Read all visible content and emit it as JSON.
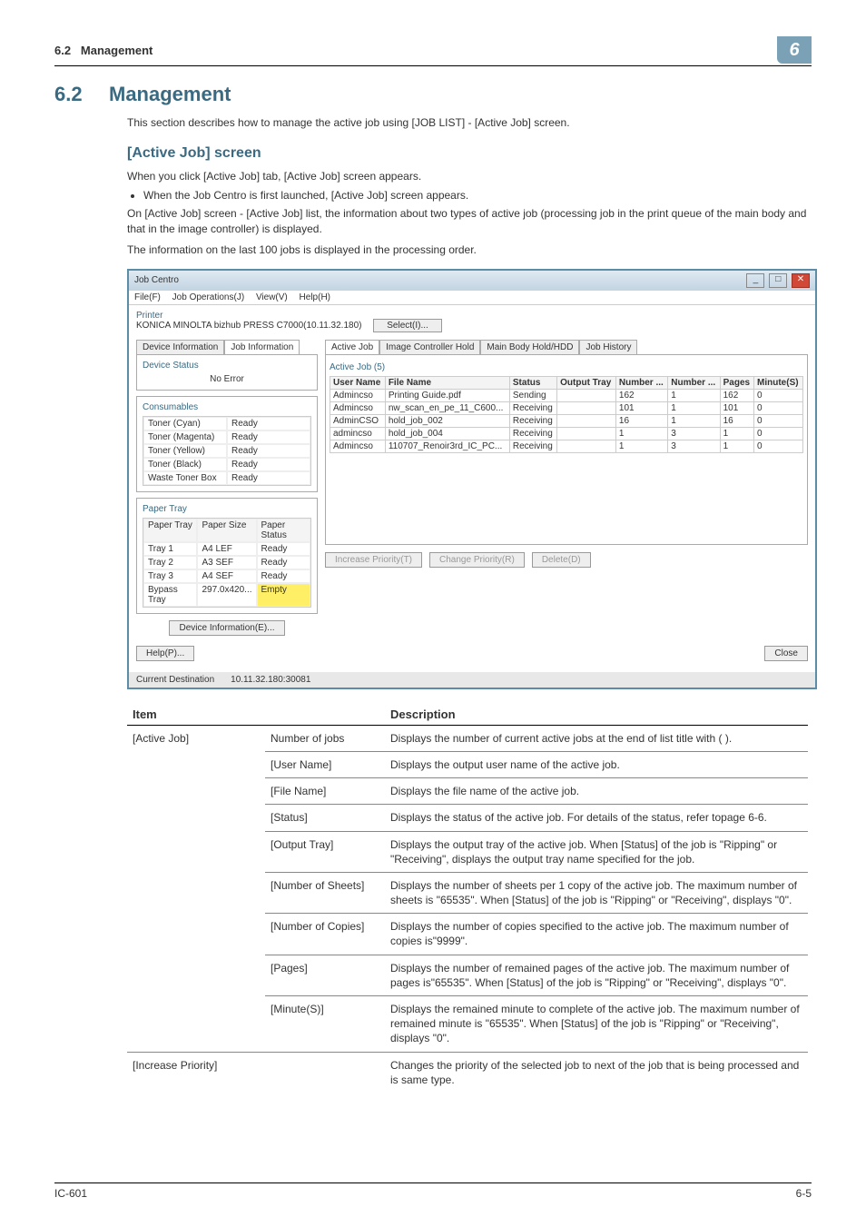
{
  "top": {
    "section": "6.2",
    "title": "Management",
    "chapter": "6"
  },
  "h1num": "6.2",
  "h1": "Management",
  "intro": "This section describes how to manage the active job using [JOB LIST] - [Active Job] screen.",
  "h2": "[Active Job] screen",
  "p1": "When you click [Active Job] tab, [Active Job] screen appears.",
  "bullet1": "When the Job Centro is first launched, [Active Job] screen appears.",
  "p2": "On [Active Job] screen - [Active Job] list, the information about two types of active job (processing job in the print queue of the main body and that in the image controller) is displayed.",
  "p3": "The information on the last 100 jobs is displayed in the processing order.",
  "win": {
    "title": "Job Centro",
    "menu": [
      "File(F)",
      "Job Operations(J)",
      "View(V)",
      "Help(H)"
    ],
    "printerLabel": "Printer",
    "printerLine": "KONICA MINOLTA bizhub PRESS C7000(10.11.32.180)",
    "selectBtn": "Select(I)...",
    "devTabs": [
      "Device Information",
      "Job Information"
    ],
    "devBox": {
      "title": "Device Status",
      "value": "No Error"
    },
    "consum": {
      "title": "Consumables",
      "rows": [
        [
          "Toner (Cyan)",
          "Ready"
        ],
        [
          "Toner (Magenta)",
          "Ready"
        ],
        [
          "Toner (Yellow)",
          "Ready"
        ],
        [
          "Toner (Black)",
          "Ready"
        ],
        [
          "Waste Toner Box",
          "Ready"
        ]
      ]
    },
    "ptray": {
      "title": "Paper Tray",
      "head": [
        "Paper Tray",
        "Paper Size",
        "Paper Status"
      ],
      "rows": [
        [
          "Tray 1",
          "A4 LEF",
          "Ready"
        ],
        [
          "Tray 2",
          "A3 SEF",
          "Ready"
        ],
        [
          "Tray 3",
          "A4 SEF",
          "Ready"
        ],
        [
          "Bypass Tray",
          "297.0x420...",
          "Empty"
        ]
      ]
    },
    "devInfoBtn": "Device Information(E)...",
    "rtabs": [
      "Active Job",
      "Image Controller Hold",
      "Main Body Hold/HDD",
      "Job History"
    ],
    "ajLabel": "Active Job (5)",
    "jhead": [
      "User Name",
      "File Name",
      "Status",
      "Output Tray",
      "Number ...",
      "Number ...",
      "Pages",
      "Minute(S)"
    ],
    "jrows": [
      [
        "Admincso",
        "Printing Guide.pdf",
        "Sending",
        "",
        "162",
        "1",
        "162",
        "0"
      ],
      [
        "Admincso",
        "nw_scan_en_pe_11_C600...",
        "Receiving",
        "",
        "101",
        "1",
        "101",
        "0"
      ],
      [
        "AdminCSO",
        "hold_job_002",
        "Receiving",
        "",
        "16",
        "1",
        "16",
        "0"
      ],
      [
        "admincso",
        "hold_job_004",
        "Receiving",
        "",
        "1",
        "3",
        "1",
        "0"
      ],
      [
        "Admincso",
        "110707_Renoir3rd_IC_PC...",
        "Receiving",
        "",
        "1",
        "3",
        "1",
        "0"
      ]
    ],
    "btns": {
      "inc": "Increase Priority(T)",
      "chg": "Change Priority(R)",
      "del": "Delete(D)"
    },
    "helpBtn": "Help(P)...",
    "closeBtn": "Close",
    "status": {
      "dest": "Current Destination",
      "addr": "10.11.32.180:30081"
    }
  },
  "dtable": {
    "h1": "Item",
    "h2": "Description",
    "rows": [
      {
        "c1": "[Active Job]",
        "c2": "Number of jobs",
        "c3": "Displays the number of current active jobs at the end of list title with ( )."
      },
      {
        "c1": "",
        "c2": "[User Name]",
        "c3": "Displays the output user name of the active job."
      },
      {
        "c1": "",
        "c2": "[File Name]",
        "c3": "Displays the file name of the active job."
      },
      {
        "c1": "",
        "c2": "[Status]",
        "c3": "Displays the status of the active job. For details of the status, refer topage 6-6."
      },
      {
        "c1": "",
        "c2": "[Output Tray]",
        "c3": "Displays the output tray of the active job. When [Status] of the job is \"Ripping\" or \"Receiving\", displays the output tray name specified for the job."
      },
      {
        "c1": "",
        "c2": "[Number of Sheets]",
        "c3": "Displays the number of sheets per 1 copy of the active job. The maximum number of sheets is \"65535\". When [Status] of the job is \"Ripping\" or \"Receiving\", displays \"0\"."
      },
      {
        "c1": "",
        "c2": "[Number of Copies]",
        "c3": "Displays the number of copies specified to the active job. The maximum number of copies is\"9999\"."
      },
      {
        "c1": "",
        "c2": "[Pages]",
        "c3": "Displays the number of remained pages of the active job. The maximum number of pages is\"65535\". When [Status] of the job is \"Ripping\" or \"Receiving\", displays \"0\"."
      },
      {
        "c1": "",
        "c2": "[Minute(S)]",
        "c3": "Displays the remained minute to complete of the active job. The maximum number of remained minute is \"65535\". When [Status] of the job is \"Ripping\" or \"Receiving\", displays \"0\"."
      },
      {
        "c1": "[Increase Priority]",
        "c2": "",
        "c3": "Changes the priority of the selected job to next of the job that is being processed and is same type."
      }
    ]
  },
  "footer": {
    "left": "IC-601",
    "right": "6-5"
  }
}
